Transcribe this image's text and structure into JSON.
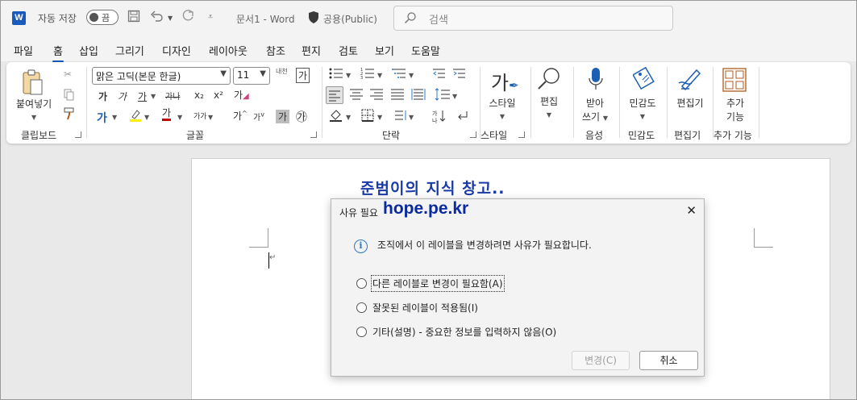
{
  "titlebar": {
    "app_logo": "W",
    "autosave_label": "자동 저장",
    "autosave_state": "끔",
    "doc_name": "문서1",
    "separator": "-",
    "app_name": "Word",
    "sensitivity_label": "공용(Public)",
    "search_placeholder": "검색"
  },
  "menu": {
    "items": [
      "파일",
      "홈",
      "삽입",
      "그리기",
      "디자인",
      "레이아웃",
      "참조",
      "편지",
      "검토",
      "보기",
      "도움말"
    ],
    "active": "홈"
  },
  "ribbon": {
    "clipboard": {
      "paste": "붙여넣기",
      "group": "클립보드"
    },
    "font": {
      "name": "맑은 고딕(본문 한글)",
      "size": "11",
      "group": "글꼴",
      "phonetic": "내천",
      "char_border": "가",
      "bold": "가",
      "italic": "가",
      "underline": "가",
      "strike": "가나",
      "subscript": "x₂",
      "superscript": "x²",
      "clear": "가",
      "text_effect": "가",
      "highlight": "가",
      "font_color": "가",
      "case": "가가",
      "grow": "가",
      "shrink": "가",
      "shading": "가",
      "enclosed": "㉮"
    },
    "paragraph": {
      "group": "단락"
    },
    "styles": {
      "label": "스타일",
      "group": "스타일",
      "icon_char": "가"
    },
    "editing": {
      "label": "편집"
    },
    "voice": {
      "label_line1": "받아",
      "label_line2": "쓰기",
      "group": "음성"
    },
    "sensitivity": {
      "label": "민감도",
      "group": "민감도"
    },
    "editor": {
      "label": "편집기",
      "group": "편집기"
    },
    "addins": {
      "label_line1": "추가",
      "label_line2": "기능",
      "group": "추가 기능"
    }
  },
  "document": {
    "body_text": "준범이의 지식 창고.."
  },
  "dialog": {
    "title": "사유 필요",
    "watermark": "hope.pe.kr",
    "close": "✕",
    "message": "조직에서 이 레이블을 변경하려면 사유가 필요합니다.",
    "options": [
      "다른 레이블로 변경이 필요함(A)",
      "잘못된 레이블이 적용됨(I)",
      "기타(설명) - 중요한 정보를 입력하지 않음(O)"
    ],
    "change_button": "변경(C)",
    "cancel_button": "취소"
  },
  "colors": {
    "accent": "#185abd",
    "highlight_bar": "#ffef00",
    "font_color_bar": "#c00000",
    "text_effect": "#1d5fb4",
    "watermark": "#0b2aa0",
    "doc_text": "#1a3aa8"
  },
  "icons": [
    "word-logo-icon",
    "save-icon",
    "undo-icon",
    "redo-icon",
    "customize-icon",
    "shield-icon",
    "search-icon",
    "paste-icon",
    "cut-icon",
    "copy-icon",
    "format-painter-icon",
    "styles-icon",
    "find-icon",
    "microphone-icon",
    "sensitivity-icon",
    "editor-icon",
    "addins-icon",
    "info-icon",
    "close-icon"
  ]
}
